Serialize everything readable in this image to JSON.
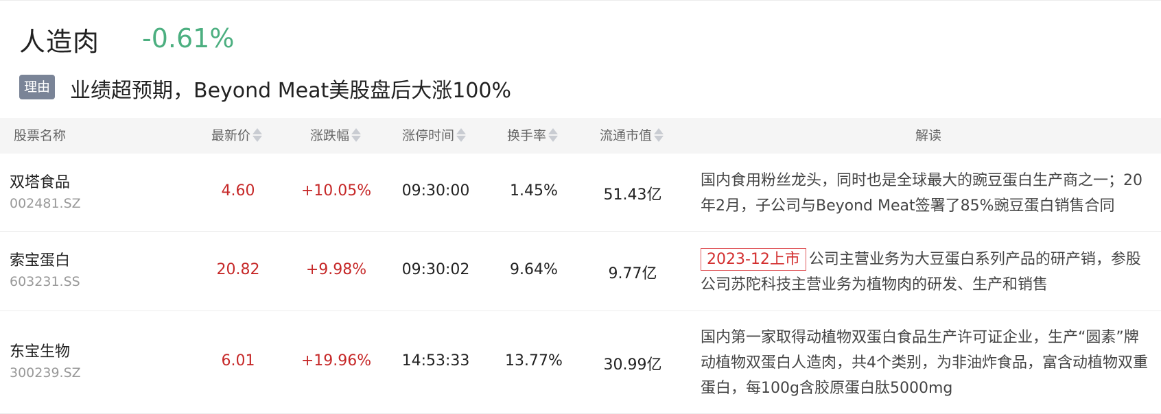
{
  "header": {
    "title": "人造肉",
    "change": "-0.61%",
    "reason_label": "理由",
    "reason_text": "业绩超预期，Beyond Meat美股盘后大涨100%"
  },
  "table": {
    "columns": [
      {
        "label": "股票名称",
        "sortable": false
      },
      {
        "label": "最新价",
        "sortable": true
      },
      {
        "label": "涨跌幅",
        "sortable": true
      },
      {
        "label": "涨停时间",
        "sortable": true
      },
      {
        "label": "换手率",
        "sortable": true
      },
      {
        "label": "流通市值",
        "sortable": true
      },
      {
        "label": "解读",
        "sortable": false
      }
    ],
    "rows": [
      {
        "name": "双塔食品",
        "code": "002481.SZ",
        "price": "4.60",
        "change": "+10.05%",
        "limit_time": "09:30:00",
        "turnover": "1.45%",
        "market_cap": "51.43亿",
        "badge": "",
        "description": "国内食用粉丝龙头，同时也是全球最大的豌豆蛋白生产商之一；20年2月，子公司与Beyond Meat签署了85%豌豆蛋白销售合同"
      },
      {
        "name": "索宝蛋白",
        "code": "603231.SS",
        "price": "20.82",
        "change": "+9.98%",
        "limit_time": "09:30:02",
        "turnover": "9.64%",
        "market_cap": "9.77亿",
        "badge": "2023-12上市",
        "description": "公司主营业务为大豆蛋白系列产品的研产销，参股公司苏陀科技主营业务为植物肉的研发、生产和销售"
      },
      {
        "name": "东宝生物",
        "code": "300239.SZ",
        "price": "6.01",
        "change": "+19.96%",
        "limit_time": "14:53:33",
        "turnover": "13.77%",
        "market_cap": "30.99亿",
        "badge": "",
        "description": "国内第一家取得动植物双蛋白食品生产许可证企业，生产“圆素”牌动植物双蛋白人造肉，共4个类别，为非油炸食品，富含动植物双重蛋白，每100g含胶原蛋白肽5000mg"
      }
    ]
  }
}
